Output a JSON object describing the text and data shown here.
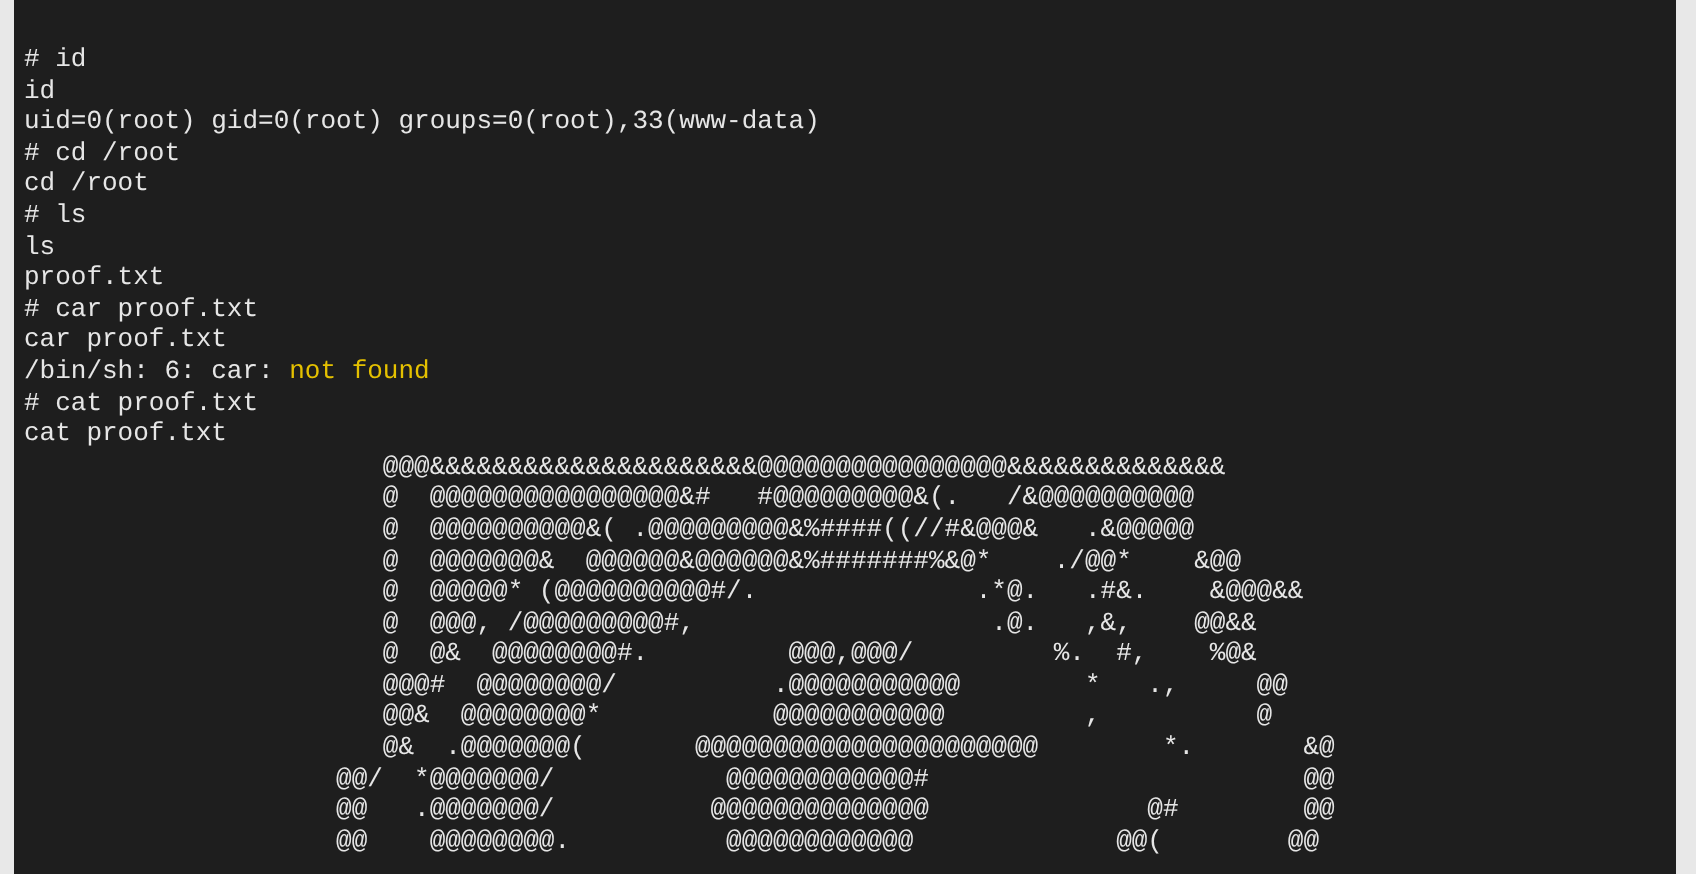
{
  "terminal": {
    "lines": [
      [
        {
          "text": "# id",
          "kind": "plain"
        }
      ],
      [
        {
          "text": "id",
          "kind": "plain"
        }
      ],
      [
        {
          "text": "uid=0(root) gid=0(root) groups=0(root),33(www-data)",
          "kind": "plain"
        }
      ],
      [
        {
          "text": "# cd /root",
          "kind": "plain"
        }
      ],
      [
        {
          "text": "cd /root",
          "kind": "plain"
        }
      ],
      [
        {
          "text": "# ls",
          "kind": "plain"
        }
      ],
      [
        {
          "text": "ls",
          "kind": "plain"
        }
      ],
      [
        {
          "text": "proof.txt",
          "kind": "plain"
        }
      ],
      [
        {
          "text": "# car proof.txt",
          "kind": "plain"
        }
      ],
      [
        {
          "text": "car proof.txt",
          "kind": "plain"
        }
      ],
      [
        {
          "text": "/bin/sh: 6: car: ",
          "kind": "plain"
        },
        {
          "text": "not found",
          "kind": "warning"
        }
      ],
      [
        {
          "text": "# cat proof.txt",
          "kind": "plain"
        }
      ],
      [
        {
          "text": "cat proof.txt",
          "kind": "plain"
        }
      ]
    ],
    "ascii_art": [
      "   @@@&&&&&&&&&&&&&&&&&&&&&@@@@@@@@@@@@@@@@&&&&&&&&&&&&&&",
      "   @  @@@@@@@@@@@@@@@@&#   #@@@@@@@@@&(.   /&@@@@@@@@@@",
      "   @  @@@@@@@@@@&( .@@@@@@@@@&%####((//#&@@@&   .&@@@@@",
      "   @  @@@@@@@&  @@@@@@&@@@@@@&%#######%&@*    ./@@*    &@@",
      "   @  @@@@@* (@@@@@@@@@@#/.              .*@.   .#&.    &@@@&&",
      "   @  @@@, /@@@@@@@@@#,                   .@.   ,&,    @@&&",
      "   @  @&  @@@@@@@@#.         @@@,@@@/         %.  #,    %@&",
      "   @@@#  @@@@@@@@/          .@@@@@@@@@@@        *   .,     @@",
      "   @@&  @@@@@@@@*           @@@@@@@@@@@         ,          @",
      "   @&  .@@@@@@@(       @@@@@@@@@@@@@@@@@@@@@@        *.       &@",
      "@@/  *@@@@@@@/           @@@@@@@@@@@@#                        @@",
      "@@   .@@@@@@@/          @@@@@@@@@@@@@@              @#        @@",
      "@@    @@@@@@@@.          @@@@@@@@@@@@             @@(        @@"
    ]
  }
}
